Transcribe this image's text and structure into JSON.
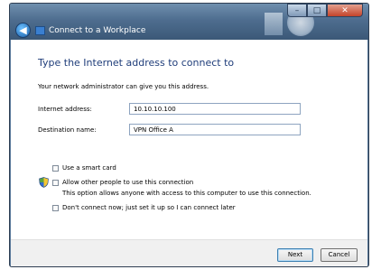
{
  "window": {
    "title": "Connect to a Workplace",
    "controls": {
      "minimize": "–",
      "maximize": "□",
      "close": "✕"
    }
  },
  "nav": {
    "back_glyph": "◀"
  },
  "main": {
    "heading": "Type the Internet address to connect to",
    "subtext": "Your network administrator can give you this address.",
    "internet_address": {
      "label": "Internet address:",
      "value": "10.10.10.100"
    },
    "destination_name": {
      "label": "Destination name:",
      "value": "VPN Office A"
    },
    "options": {
      "smart_card": {
        "label": "Use a smart card",
        "checked": false
      },
      "allow_others": {
        "label": "Allow other people to use this connection",
        "checked": false,
        "description": "This option allows anyone with access to this computer to use this connection.",
        "icon": "shield-icon"
      },
      "dont_connect": {
        "label": "Don't connect now; just set it up so I can connect later",
        "checked": false
      }
    }
  },
  "footer": {
    "next_label": "Next",
    "cancel_label": "Cancel"
  }
}
